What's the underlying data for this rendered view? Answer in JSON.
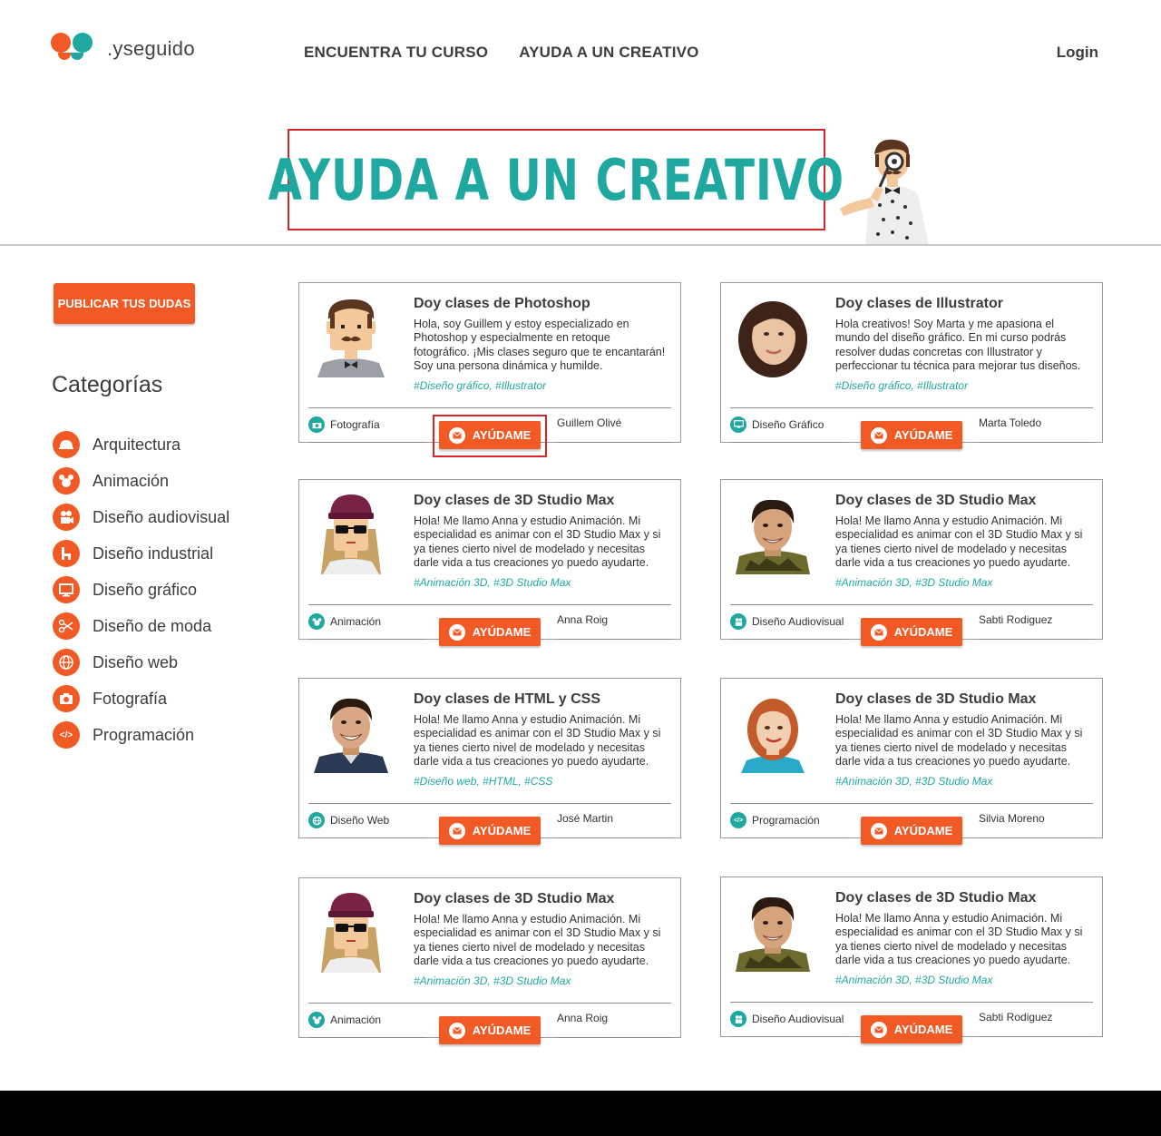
{
  "brand": {
    "logo_text": ".yseguido",
    "colors": {
      "orange": "#f15a24",
      "teal": "#1fa8a0",
      "highlight": "#d9262b"
    }
  },
  "nav": {
    "items": [
      "ENCUENTRA TU CURSO",
      "AYUDA A UN CREATIVO"
    ],
    "login": "Login"
  },
  "hero": {
    "title": "AYUDA A UN CREATIVO"
  },
  "sidebar": {
    "publish_button": "PUBLICAR TUS DUDAS",
    "categories_title": "Categorías",
    "categories": [
      {
        "label": "Arquitectura",
        "icon": "helmet-icon"
      },
      {
        "label": "Animación",
        "icon": "mouse-ears-icon"
      },
      {
        "label": "Diseño audiovisual",
        "icon": "video-camera-icon"
      },
      {
        "label": "Diseño industrial",
        "icon": "chair-icon"
      },
      {
        "label": "Diseño gráfico",
        "icon": "monitor-icon"
      },
      {
        "label": "Diseño de moda",
        "icon": "scissors-icon"
      },
      {
        "label": "Diseño web",
        "icon": "globe-icon"
      },
      {
        "label": "Fotografía",
        "icon": "camera-icon"
      },
      {
        "label": "Programación",
        "icon": "code-icon"
      }
    ]
  },
  "help_label": "AYÚDAME",
  "cards": [
    {
      "title": "Doy clases de Photoshop",
      "desc": "Hola, soy Guillem y estoy especializado en Photoshop y especialmente en retoque fotográfico. ¡Mis clases seguro que te encantarán! Soy una persona dinámica y humilde.",
      "tags": "#Diseño gráfico, #Illustrator",
      "category": "Fotografía",
      "category_icon": "camera-icon",
      "author": "Guillem Olivé",
      "avatar": "illustrated-man-mustache"
    },
    {
      "title": "Doy clases de Illustrator",
      "desc": "Hola creativos! Soy Marta y me apasiona el mundo del diseño gráfico. En mi curso podrás resolver dudas concretas con Illustrator y perfeccionar tu técnica para mejorar tus diseños.",
      "tags": "#Diseño gráfico, #Illustrator",
      "category": "Diseño Gráfico",
      "category_icon": "monitor-icon",
      "author": "Marta Toledo",
      "avatar": "photo-woman-brunette"
    },
    {
      "title": "Doy clases de 3D Studio Max",
      "desc": "Hola! Me llamo Anna y estudio Animación. Mi especialidad es animar con el 3D Studio Max y si ya tienes cierto nivel de modelado y necesitas darle vida a tus creaciones yo puedo ayudarte.",
      "tags": "#Animación 3D, #3D Studio Max",
      "category": "Animación",
      "category_icon": "mouse-ears-icon",
      "author": "Anna Roig",
      "avatar": "illustrated-woman-beanie"
    },
    {
      "title": "Doy clases de 3D Studio Max",
      "desc": "Hola! Me llamo Anna y estudio Animación. Mi especialidad es animar con el 3D Studio Max y si ya tienes cierto nivel de modelado y necesitas darle vida a tus creaciones yo puedo ayudarte.",
      "tags": "#Animación 3D, #3D Studio Max",
      "category": "Diseño Audiovisual",
      "category_icon": "video-camera-icon",
      "author": "Sabti Rodiguez",
      "avatar": "photo-man-young"
    },
    {
      "title": "Doy clases de HTML y CSS",
      "desc": "Hola! Me llamo Anna y estudio Animación. Mi especialidad es animar con el 3D Studio Max y si ya tienes cierto nivel de modelado y necesitas darle vida a tus creaciones yo puedo ayudarte.",
      "tags": "#Diseño web, #HTML, #CSS",
      "category": "Diseño Web",
      "category_icon": "globe-icon",
      "author": "José Martin",
      "avatar": "photo-man-smiling"
    },
    {
      "title": "Doy clases de 3D Studio Max",
      "desc": "Hola! Me llamo Anna y estudio Animación. Mi especialidad es animar con el 3D Studio Max y si ya tienes cierto nivel de modelado y necesitas darle vida a tus creaciones yo puedo ayudarte.",
      "tags": "#Animación 3D, #3D Studio Max",
      "category": "Programación",
      "category_icon": "code-icon",
      "author": "Silvia Moreno",
      "avatar": "photo-woman-redhead"
    },
    {
      "title": "Doy clases de 3D Studio Max",
      "desc": "Hola! Me llamo Anna y estudio Animación. Mi especialidad es animar con el 3D Studio Max y si ya tienes cierto nivel de modelado y necesitas darle vida a tus creaciones yo puedo ayudarte.",
      "tags": "#Animación 3D, #3D Studio Max",
      "category": "Animación",
      "category_icon": "mouse-ears-icon",
      "author": "Anna Roig",
      "avatar": "illustrated-woman-beanie"
    },
    {
      "title": "Doy clases de 3D Studio Max",
      "desc": "Hola! Me llamo Anna y estudio Animación. Mi especialidad es animar con el 3D Studio Max y si ya tienes cierto nivel de modelado y necesitas darle vida a tus creaciones yo puedo ayudarte.",
      "tags": "#Animación 3D, #3D Studio Max",
      "category": "Diseño Audiovisual",
      "category_icon": "video-camera-icon",
      "author": "Sabti Rodiguez",
      "avatar": "photo-man-young"
    }
  ]
}
